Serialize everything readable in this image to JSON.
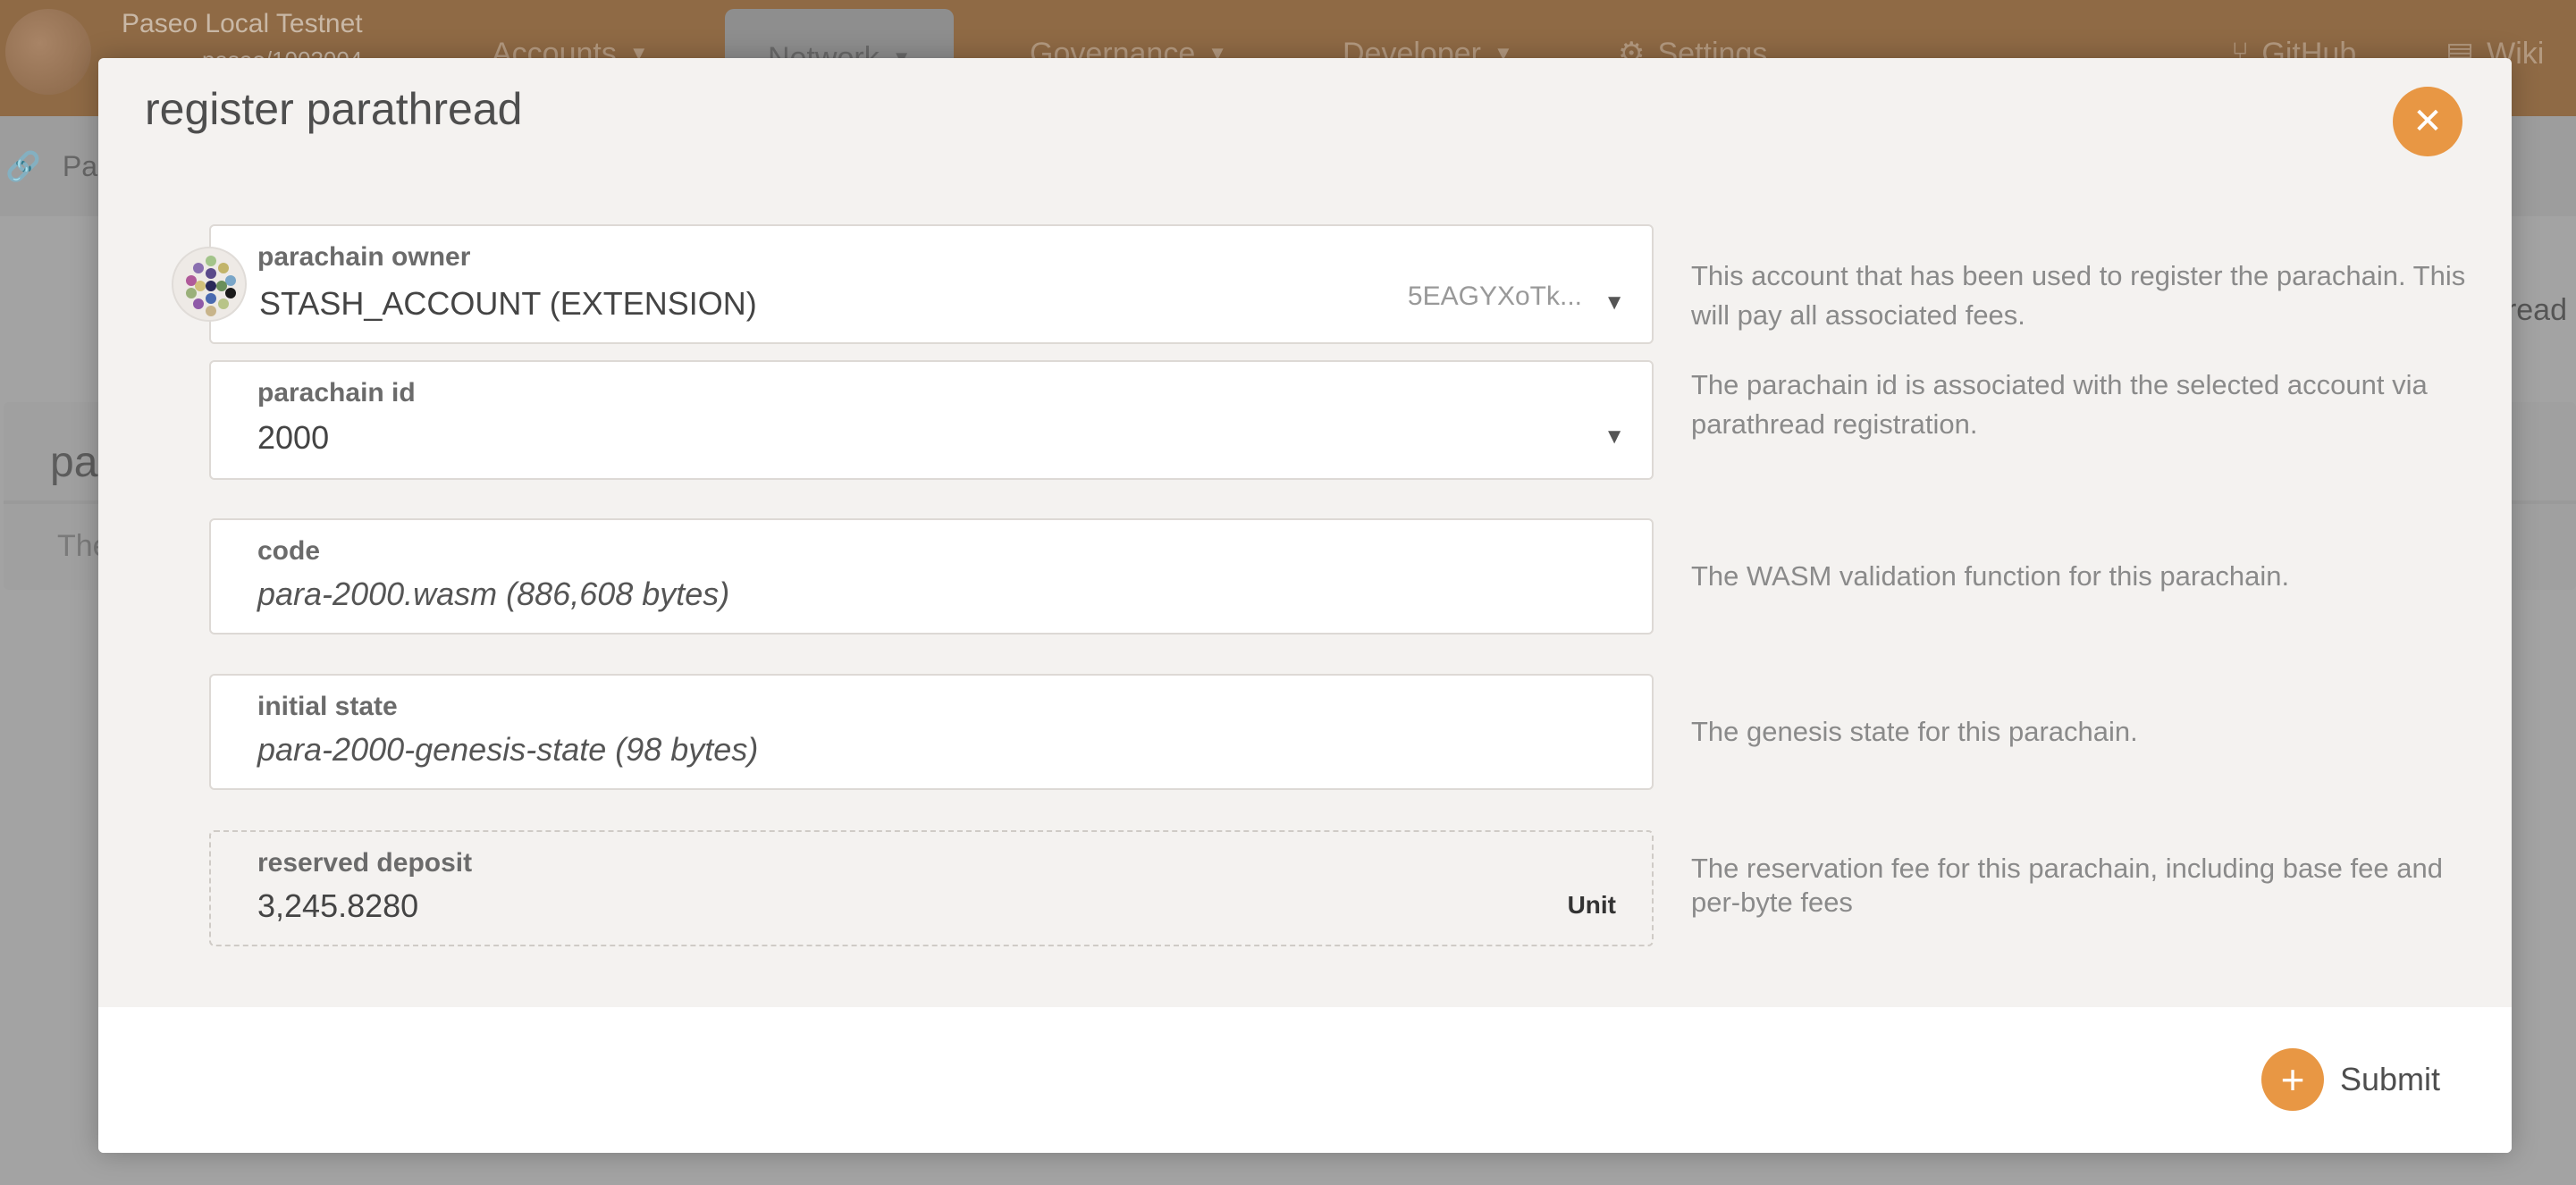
{
  "background": {
    "chain_name": "Paseo Local Testnet",
    "chain_sub": "paseo/1003004",
    "nav": [
      "Accounts",
      "Network",
      "Governance",
      "Developer",
      "Settings",
      "GitHub",
      "Wiki"
    ],
    "subbar_text": "Par",
    "card_title": "pa",
    "card_text": "The",
    "right_text": "read"
  },
  "modal": {
    "title": "register parathread",
    "close_icon": "✕",
    "fields": {
      "owner": {
        "label": "parachain owner",
        "value": "STASH_ACCOUNT (EXTENSION)",
        "address_short": "5EAGYXoTk...",
        "help": "This account that has been used to register the parachain. This will pay all associated fees."
      },
      "para_id": {
        "label": "parachain id",
        "value": "2000",
        "help": "The parachain id is associated with the selected account via parathread registration."
      },
      "code": {
        "label": "code",
        "value": "para-2000.wasm (886,608 bytes)",
        "help": "The WASM validation function for this parachain."
      },
      "initial_state": {
        "label": "initial state",
        "value": "para-2000-genesis-state (98 bytes)",
        "help": "The genesis state for this parachain."
      },
      "deposit": {
        "label": "reserved deposit",
        "value": "3,245.8280",
        "unit": "Unit",
        "help": "The reservation fee for this parachain, including base fee and per-byte fees"
      }
    },
    "submit_label": "Submit",
    "submit_icon": "+"
  },
  "colors": {
    "accent": "#e89744",
    "modal_bg": "#f4f2f0"
  }
}
